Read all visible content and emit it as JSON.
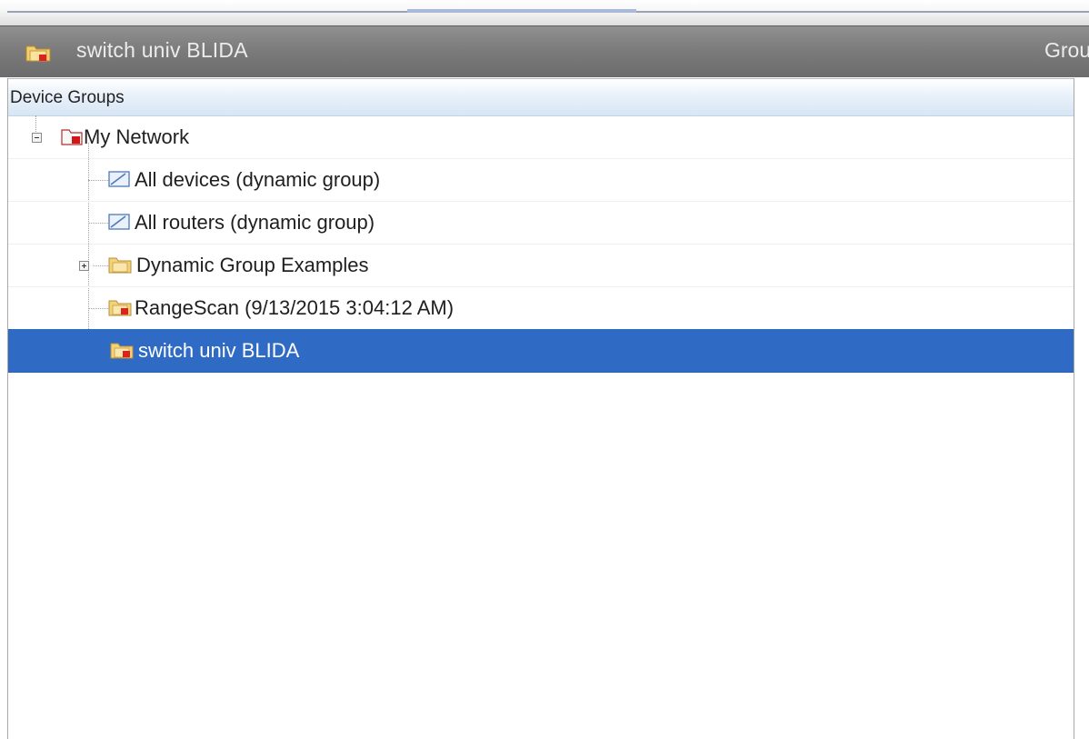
{
  "window": {
    "title": "switch univ BLIDA",
    "title_icon": "folder-group-icon",
    "right_label": "Grou"
  },
  "panel": {
    "header": "Device Groups"
  },
  "tree": {
    "root": {
      "label": "My Network",
      "icon": "network-folder-icon",
      "expanded": true
    },
    "items": [
      {
        "label": "All devices (dynamic group)",
        "icon": "dynamic-group-icon",
        "selected": false
      },
      {
        "label": "All routers (dynamic group)",
        "icon": "dynamic-group-icon",
        "selected": false
      },
      {
        "label": "Dynamic Group Examples",
        "icon": "folder-icon",
        "expandable": true,
        "selected": false
      },
      {
        "label": "RangeScan (9/13/2015 3:04:12 AM)",
        "icon": "folder-group-icon",
        "selected": false
      },
      {
        "label": "switch univ BLIDA",
        "icon": "folder-group-icon",
        "selected": true
      }
    ]
  },
  "colors": {
    "selection": "#2f6ac4",
    "title_bar": "#7a7a7a",
    "header_bg": "#d7e6f5"
  }
}
